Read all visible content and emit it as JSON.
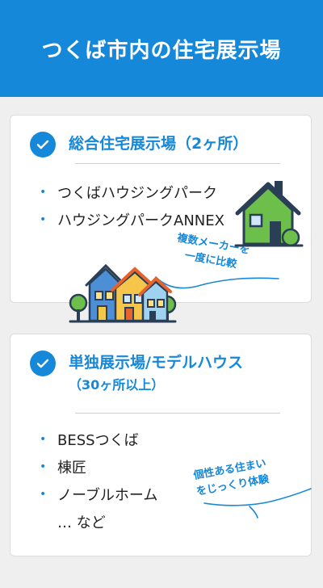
{
  "header": {
    "title": "つくば市内の住宅展示場"
  },
  "cards": [
    {
      "title": "総合住宅展示場",
      "title_small": "（2ヶ所）",
      "items": [
        "つくばハウジングパーク",
        "ハウジングパークANNEX"
      ],
      "note_lines": [
        "複数メーカーを",
        "一度に比較"
      ],
      "icon": "houses-icon"
    },
    {
      "title": "単独展示場/モデルハウス",
      "subtitle": "（30ヶ所以上）",
      "items": [
        "BESSつくば",
        "棟匠",
        "ノーブルホーム"
      ],
      "more": "… など",
      "note_lines": [
        "個性ある住まい",
        "をじっくり体験"
      ],
      "icon": "house-icon"
    }
  ],
  "colors": {
    "accent": "#1688d9",
    "background": "#efefef",
    "card": "#ffffff"
  }
}
